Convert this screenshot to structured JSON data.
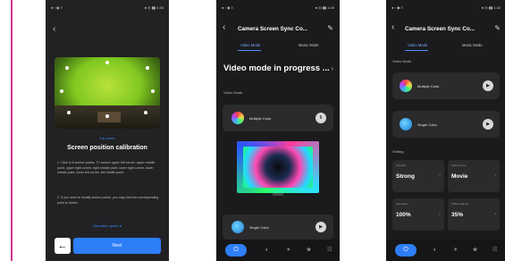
{
  "colors": {
    "accent": "#2d7ef7",
    "link": "#3b82f6",
    "panel": "#2b2b2d",
    "background": "#1b1b1d"
  },
  "screen1": {
    "status_left": "● ‹ ◉ ≡",
    "status_right": "● ◎ ▮▮ 1:40",
    "back_icon": "back-arrow",
    "hint": "Full screen",
    "title": "Screen position calibration",
    "step1": "1. Click to 8 anchor points: TV screen upper left corner, upper middle point, upper right corner, right middle point, lower right corner, lower middle point, lower left corner, left middle point.",
    "step2": "2. If you need to modify anchor points, you may click the corresponding point to delete.",
    "guide": "Operation guide ●",
    "prev_icon": "←",
    "next": "Next"
  },
  "screen2": {
    "status_left": "● ‹ ◉ ≡",
    "status_right": "● ◎ ▮▮ 1:40",
    "title": "Camera Screen Sync Co...",
    "tabs": [
      "Video Mode",
      "Music Mode"
    ],
    "status_text": "Video mode in progress ...",
    "section": "Video Mode",
    "modes": [
      {
        "label": "Multiple Color",
        "action": "‖"
      },
      {
        "label": "Single Color",
        "action": "▶"
      }
    ]
  },
  "screen3": {
    "status_left": "● ‹ ◉ ≡",
    "status_right": "● ◎ ▮▮ 1:40",
    "title": "Camera Screen Sync Co...",
    "tabs": [
      "Video Mode",
      "Music Mode"
    ],
    "section_mode": "Video Mode",
    "modes": [
      {
        "label": "Multiple Color",
        "action": "▶"
      },
      {
        "label": "Single Color",
        "action": "▶"
      }
    ],
    "section_setting": "Setting",
    "settings": [
      {
        "label": "Intensity",
        "value": "Strong"
      },
      {
        "label": "Video scene",
        "value": "Movie"
      },
      {
        "label": "Saturation",
        "value": "100%"
      },
      {
        "label": "White balance",
        "value": "35%"
      }
    ]
  },
  "nav": {
    "power": "⏻",
    "icons": [
      "◑",
      "☀",
      "❀",
      "☷"
    ]
  }
}
